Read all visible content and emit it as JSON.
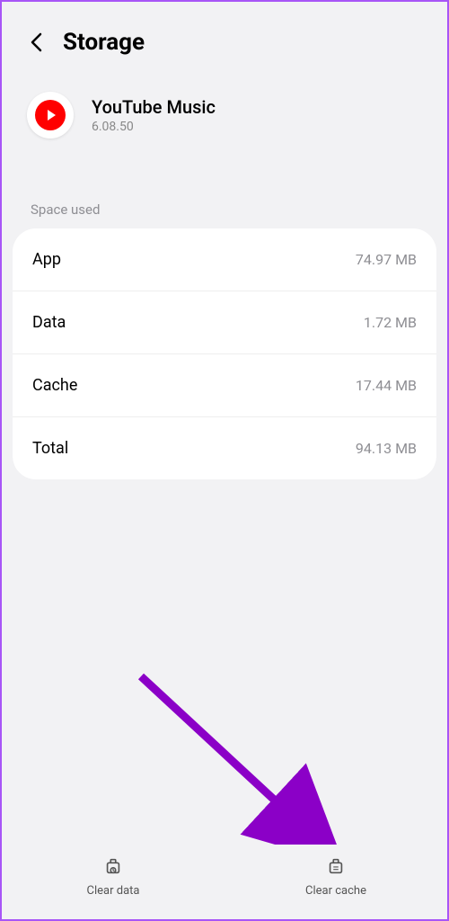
{
  "header": {
    "title": "Storage"
  },
  "app": {
    "name": "YouTube Music",
    "version": "6.08.50"
  },
  "section": {
    "label": "Space used"
  },
  "storage": [
    {
      "label": "App",
      "value": "74.97 MB"
    },
    {
      "label": "Data",
      "value": "1.72 MB"
    },
    {
      "label": "Cache",
      "value": "17.44 MB"
    },
    {
      "label": "Total",
      "value": "94.13 MB"
    }
  ],
  "actions": {
    "clear_data": "Clear data",
    "clear_cache": "Clear cache"
  }
}
